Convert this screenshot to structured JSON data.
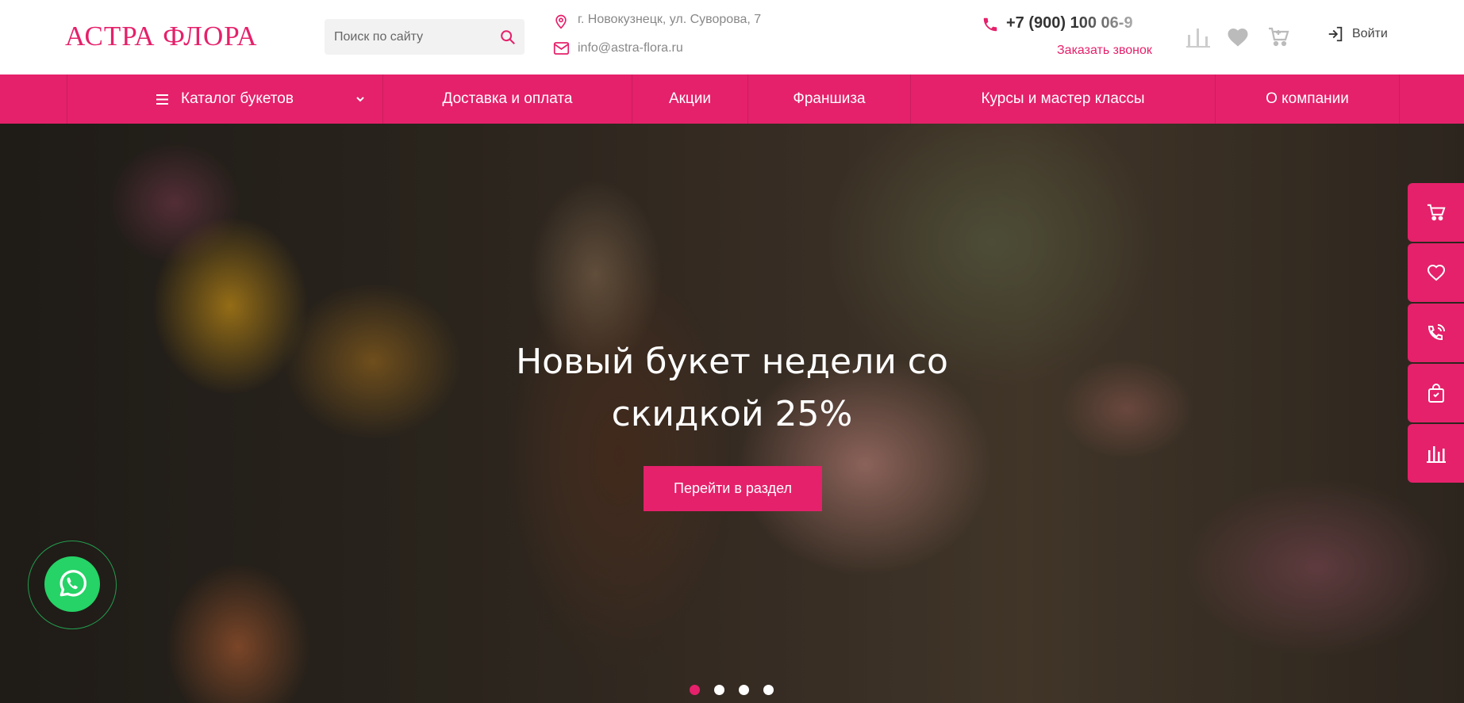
{
  "header": {
    "logo": "АСТРА ФЛОРА",
    "search": {
      "placeholder": "Поиск по сайту"
    },
    "address": "г. Новокузнецк, ул. Суворова, 7",
    "email": "info@astra-flora.ru",
    "phone": "+7 (900) 100 06-9",
    "callback": "Заказать звонок",
    "login": "Войти",
    "icons": [
      "compare-icon",
      "heart-icon",
      "cart-icon",
      "login-icon"
    ]
  },
  "nav": {
    "items": [
      {
        "label": "Каталог букетов"
      },
      {
        "label": "Доставка и оплата"
      },
      {
        "label": "Акции"
      },
      {
        "label": "Франшиза"
      },
      {
        "label": "Курсы и мастер классы"
      },
      {
        "label": "О компании"
      }
    ]
  },
  "hero": {
    "title_line1": "Новый букет недели со",
    "title_line2": "скидкой 25%",
    "button": "Перейти в раздел",
    "slides": 4,
    "active_slide": 1
  },
  "side_panel": {
    "icons": [
      "cart-icon",
      "heart-icon",
      "phone-call-icon",
      "bag-icon",
      "compare-icon"
    ]
  },
  "colors": {
    "accent": "#e5216b",
    "whatsapp": "#25d366"
  }
}
